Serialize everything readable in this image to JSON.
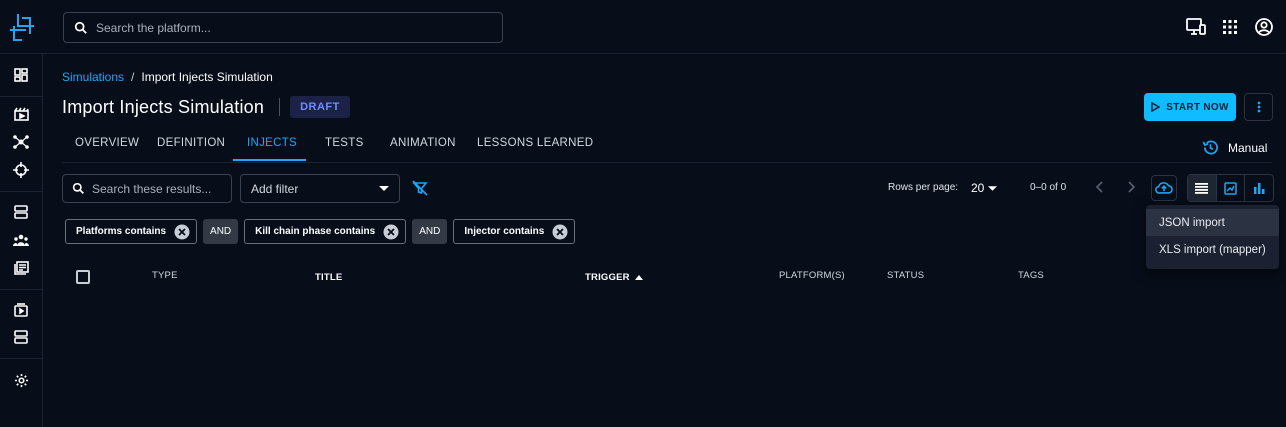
{
  "search": {
    "placeholder": "Search the platform..."
  },
  "breadcrumb": {
    "parent": "Simulations",
    "separator": "/",
    "current": "Import Injects Simulation"
  },
  "page": {
    "title": "Import Injects Simulation",
    "status_badge": "DRAFT"
  },
  "actions": {
    "start_label": "START NOW"
  },
  "tabs": [
    {
      "label": "OVERVIEW"
    },
    {
      "label": "DEFINITION"
    },
    {
      "label": "INJECTS",
      "active": true
    },
    {
      "label": "TESTS"
    },
    {
      "label": "ANIMATION"
    },
    {
      "label": "LESSONS LEARNED"
    }
  ],
  "mode": {
    "label": "Manual"
  },
  "filters": {
    "search_placeholder": "Search these results...",
    "add_filter_label": "Add filter",
    "chips": [
      {
        "label": "Platforms contains"
      },
      {
        "label": "Kill chain phase contains"
      },
      {
        "label": "Injector contains"
      }
    ],
    "operator": "AND"
  },
  "pagination": {
    "rows_label": "Rows per page:",
    "rows_value": "20",
    "range": "0–0 of 0"
  },
  "table": {
    "columns": [
      "TYPE",
      "TITLE",
      "TRIGGER",
      "PLATFORM(S)",
      "STATUS",
      "TAGS"
    ],
    "sorted_column": "TRIGGER",
    "sort_direction": "ascending"
  },
  "import_menu": {
    "items": [
      {
        "label": "JSON import"
      },
      {
        "label": "XLS import (mapper)"
      }
    ]
  },
  "colors": {
    "accent": "#1fa5f4",
    "primary_button": "#0fbcff",
    "background": "#070d19",
    "badge_text": "#6f8cff"
  }
}
